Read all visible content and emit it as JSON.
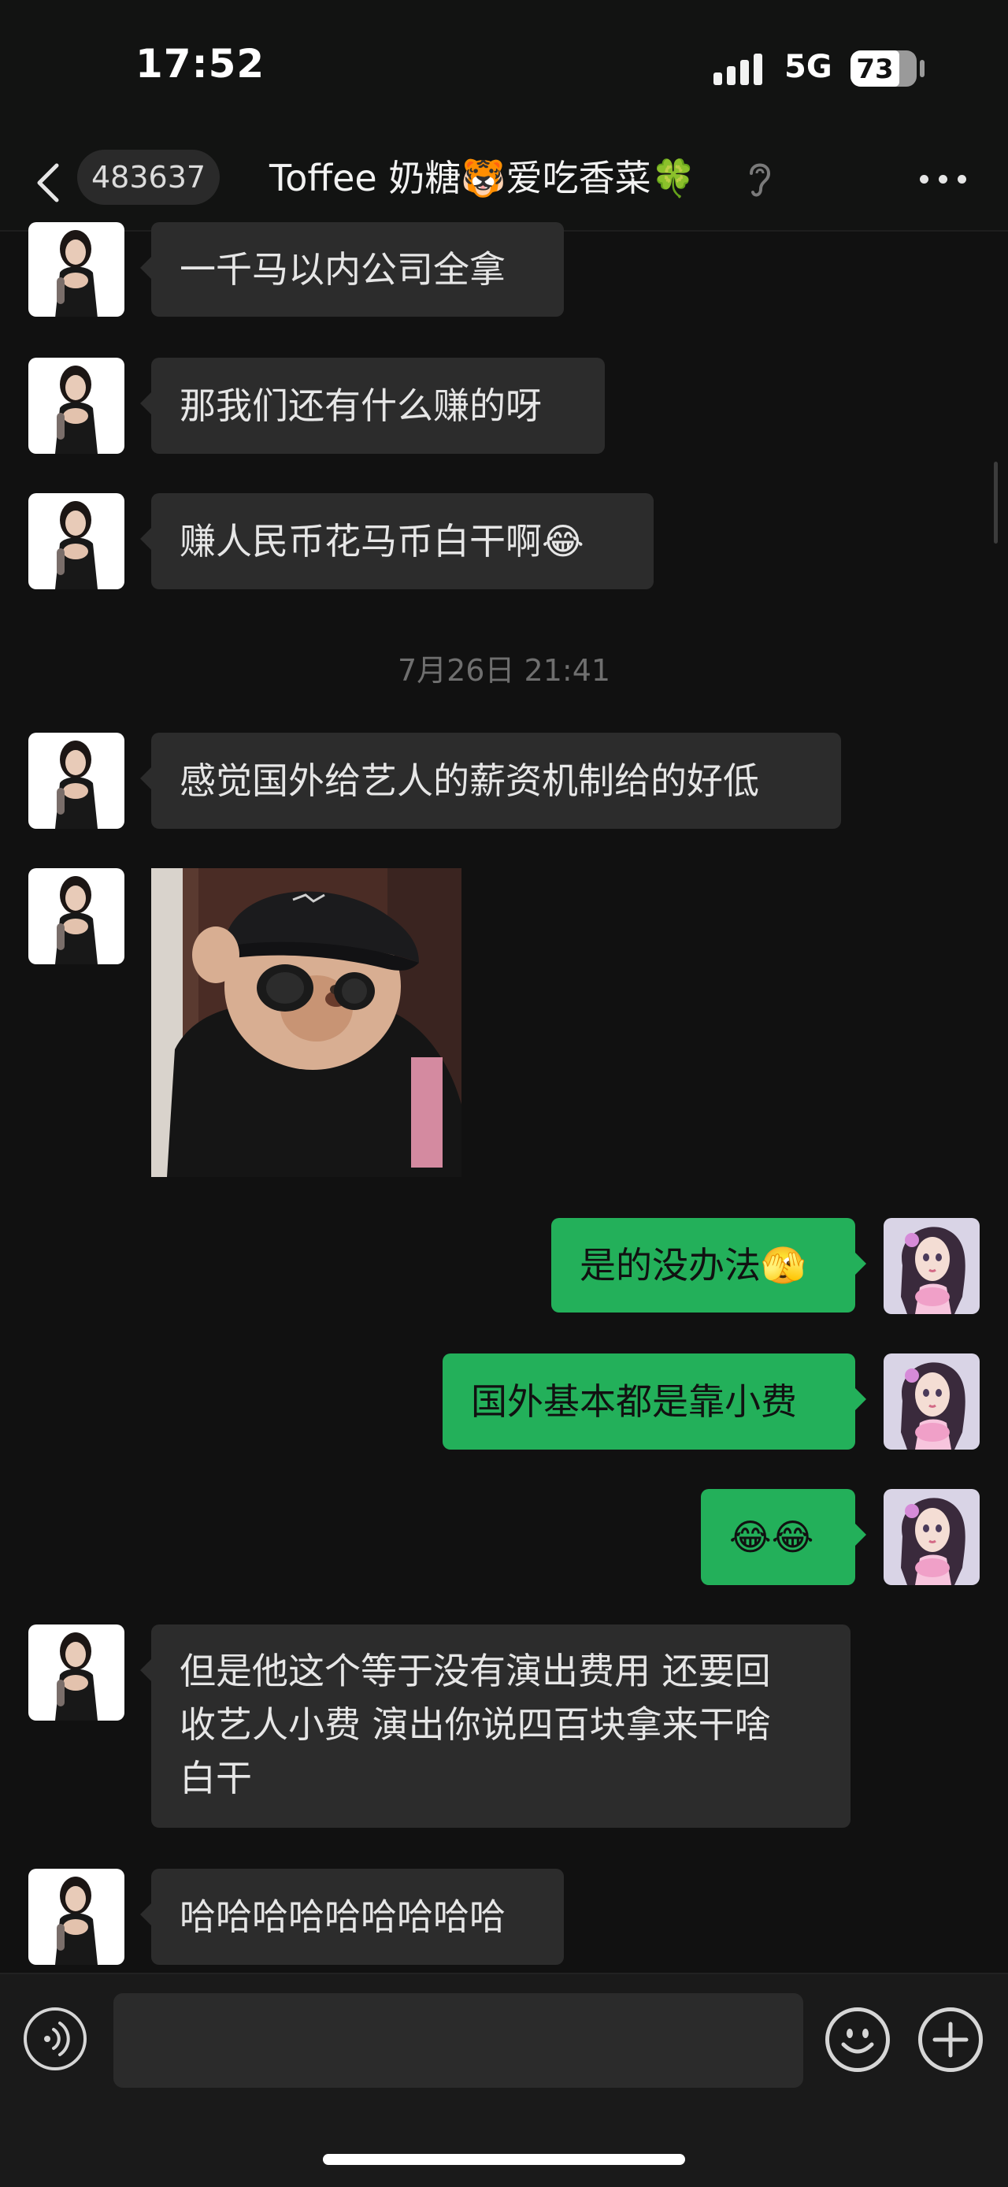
{
  "status_bar": {
    "time": "17:52",
    "network": "5G",
    "battery": "73"
  },
  "header": {
    "back_icon": "chevron-left-icon",
    "unread_badge": "483637",
    "title": "Toffee 奶糖🐯爱吃香菜🍀",
    "earpiece_icon": "ear-icon",
    "more_icon": "more-horizontal-icon"
  },
  "messages": [
    {
      "side": "left",
      "text": "一千马以内公司全拿"
    },
    {
      "side": "left",
      "text": "那我们还有什么赚的呀"
    },
    {
      "side": "left",
      "text": "赚人民币花马币白干啊😂"
    },
    {
      "side": "left",
      "text": "感觉国外给艺人的薪资机制给的好低"
    },
    {
      "side": "left",
      "type": "image",
      "image_desc": "sticker-photo"
    },
    {
      "side": "right",
      "text": "是的没办法🫣"
    },
    {
      "side": "right",
      "text": "国外基本都是靠小费"
    },
    {
      "side": "right",
      "text": "😂😂"
    },
    {
      "side": "left",
      "lines": [
        "但是他这个等于没有演出费用 还要回",
        "收艺人小费 演出你说四百块拿来干啥",
        "白干"
      ]
    },
    {
      "side": "left",
      "text": "哈哈哈哈哈哈哈哈哈"
    }
  ],
  "timestamp": "7月26日 21:41",
  "input_bar": {
    "voice_icon": "voice-icon",
    "text_value": "",
    "emoji_icon": "smiley-icon",
    "plus_icon": "plus-icon"
  },
  "colors": {
    "background": "#111111",
    "incoming_bubble": "#2c2c2c",
    "outgoing_bubble": "#23b05a"
  }
}
